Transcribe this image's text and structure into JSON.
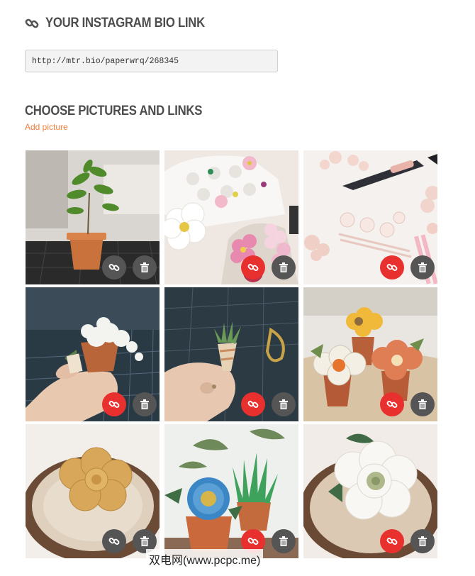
{
  "bio": {
    "title": "YOUR INSTAGRAM BIO LINK",
    "link_value": "http://mtr.bio/paperwrq/268345"
  },
  "choose": {
    "title": "CHOOSE PICTURES AND LINKS",
    "add_label": "Add picture"
  },
  "colors": {
    "accent_orange": "#f07f3c",
    "link_active_red": "#e8302e",
    "button_gray": "#555555"
  },
  "pictures": [
    {
      "subject": "fig tree in terracotta pot",
      "link_active": false
    },
    {
      "subject": "paper flowers in egg carton",
      "link_active": true
    },
    {
      "subject": "tweezers and paper blossoms",
      "link_active": true
    },
    {
      "subject": "hand holding white paper plant",
      "link_active": true
    },
    {
      "subject": "hand holding mini succulent",
      "link_active": true
    },
    {
      "subject": "felt flowers in pots",
      "link_active": true
    },
    {
      "subject": "felt rose succulent on wood slice",
      "link_active": false
    },
    {
      "subject": "blue flower and aloe pots",
      "link_active": true
    },
    {
      "subject": "white felt peony on wood slice",
      "link_active": true
    }
  ],
  "icons": {
    "header_link": "link-icon",
    "tile_link": "link-icon",
    "tile_delete": "trash-icon"
  },
  "watermark": "双电网(www.pcpc.me)"
}
